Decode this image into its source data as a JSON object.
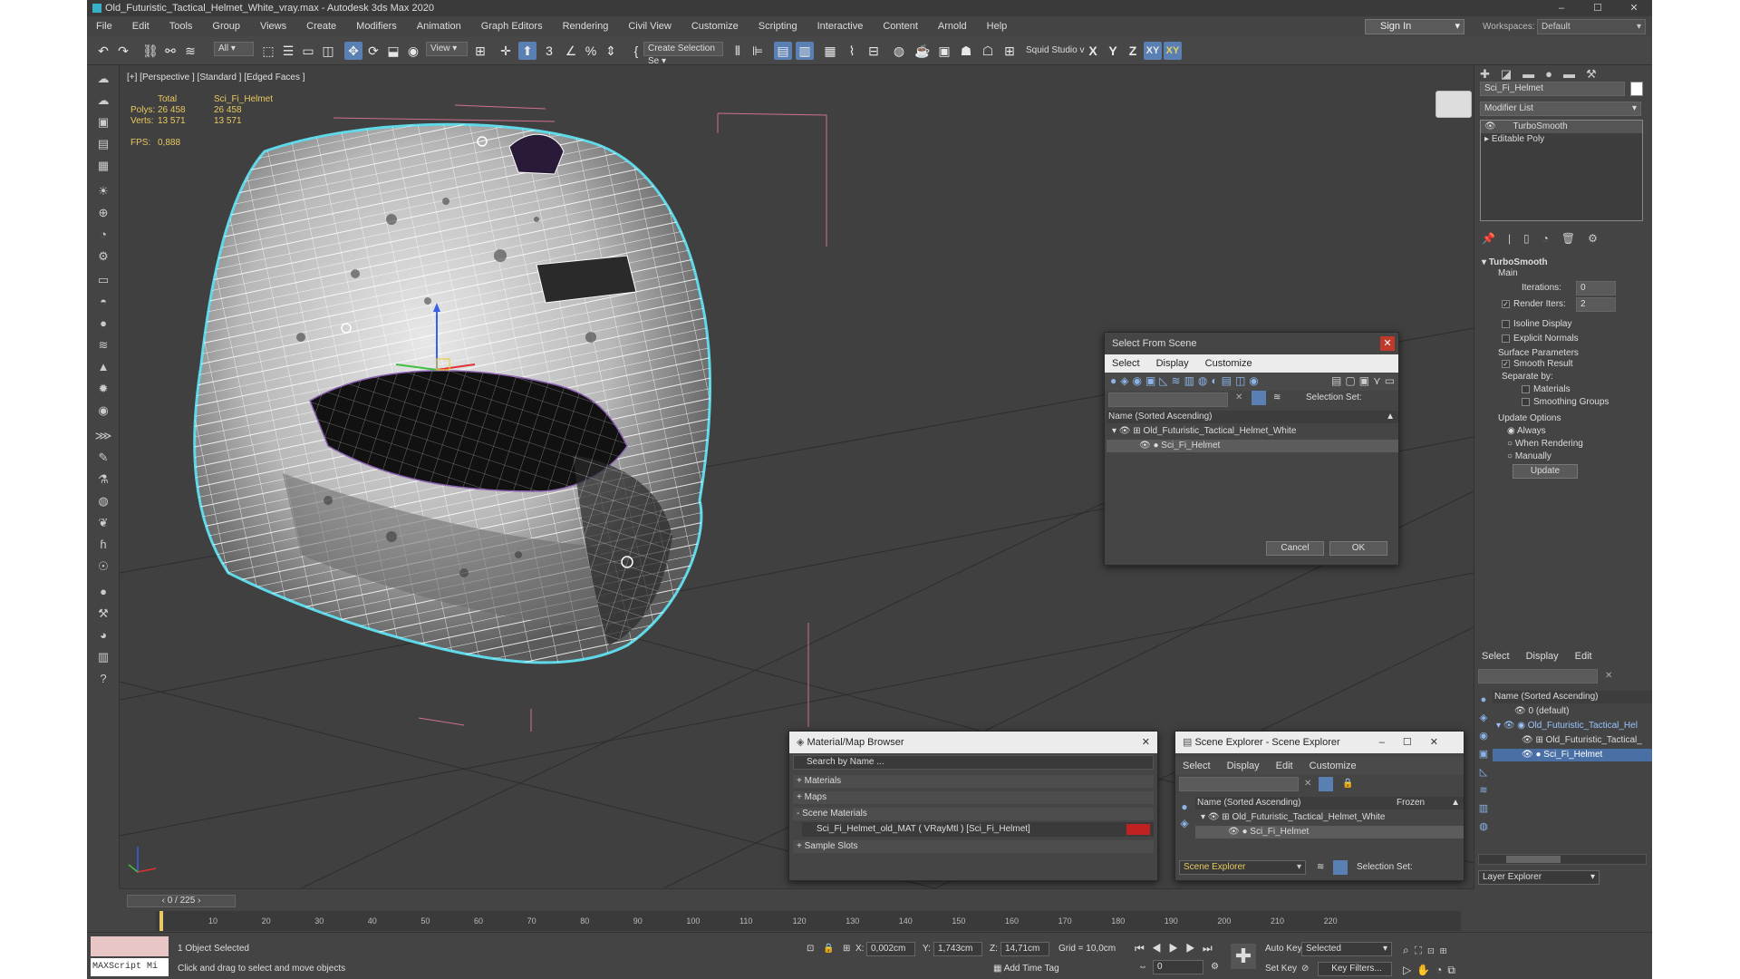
{
  "window": {
    "title": "Old_Futuristic_Tactical_Helmet_White_vray.max - Autodesk 3ds Max 2020",
    "min": "–",
    "max": "☐",
    "close": "✕"
  },
  "menu": [
    "File",
    "Edit",
    "Tools",
    "Group",
    "Views",
    "Create",
    "Modifiers",
    "Animation",
    "Graph Editors",
    "Rendering",
    "Civil View",
    "Customize",
    "Scripting",
    "Interactive",
    "Content",
    "Arnold",
    "Help"
  ],
  "account": {
    "signin": "Sign In",
    "workspace_label": "Workspaces:",
    "workspace_value": "Default"
  },
  "toolbar": {
    "filter": "All",
    "view": "View",
    "selection_set": "Create Selection Se",
    "user": "Squid Studio v",
    "axes": [
      "X",
      "Y",
      "Z",
      "XY",
      "XY"
    ]
  },
  "viewport": {
    "label": "[+] [Perspective ] [Standard ] [Edged Faces ]",
    "stats": {
      "total_label": "Total",
      "object_label": "Sci_Fi_Helmet",
      "polys_label": "Polys:",
      "polys_total": "26 458",
      "polys_obj": "26 458",
      "verts_label": "Verts:",
      "verts_total": "13 571",
      "verts_obj": "13 571",
      "fps_label": "FPS:",
      "fps_value": "0,888"
    }
  },
  "select_from_scene": {
    "title": "Select From Scene",
    "menu": [
      "Select",
      "Display",
      "Customize"
    ],
    "selection_set_label": "Selection Set:",
    "column": "Name (Sorted Ascending)",
    "items": [
      "Old_Futuristic_Tactical_Helmet_White",
      "Sci_Fi_Helmet"
    ],
    "ok": "OK",
    "cancel": "Cancel"
  },
  "material_browser": {
    "title": "Material/Map Browser",
    "search_placeholder": "Search by Name ...",
    "sections": [
      "+ Materials",
      "+ Maps",
      "- Scene Materials",
      "+ Sample Slots"
    ],
    "material_item": "Sci_Fi_Helmet_old_MAT  ( VRayMtl )  [Sci_Fi_Helmet]"
  },
  "scene_explorer": {
    "title": "Scene Explorer - Scene Explorer",
    "menu": [
      "Select",
      "Display",
      "Edit",
      "Customize"
    ],
    "column": "Name (Sorted Ascending)",
    "frozen": "Frozen",
    "items": [
      "Old_Futuristic_Tactical_Helmet_White",
      "Sci_Fi_Helmet"
    ],
    "footer_name": "Scene Explorer",
    "selection_set_label": "Selection Set:"
  },
  "command_panel": {
    "object_name": "Sci_Fi_Helmet",
    "modifier_list": "Modifier List",
    "stack": [
      "TurboSmooth",
      "Editable Poly"
    ],
    "rollout_title": "TurboSmooth",
    "main_label": "Main",
    "iterations_label": "Iterations:",
    "iterations_value": "0",
    "render_iters_label": "Render Iters:",
    "render_iters_value": "2",
    "isoline": "Isoline Display",
    "explicit": "Explicit Normals",
    "surface_params": "Surface Parameters",
    "smooth_result": "Smooth Result",
    "separate_by": "Separate by:",
    "materials": "Materials",
    "smoothing_groups": "Smoothing Groups",
    "update_options": "Update Options",
    "always": "Always",
    "when_rendering": "When Rendering",
    "manually": "Manually",
    "update": "Update"
  },
  "layer_explorer": {
    "menu": [
      "Select",
      "Display",
      "Edit"
    ],
    "column": "Name (Sorted Ascending)",
    "items": [
      "0 (default)",
      "Old_Futuristic_Tactical_Hel",
      "Old_Futuristic_Tactical_",
      "Sci_Fi_Helmet"
    ],
    "footer": "Layer Explorer"
  },
  "timeline": {
    "frame": "0 / 225",
    "ticks": [
      "10",
      "20",
      "30",
      "40",
      "50",
      "60",
      "70",
      "80",
      "90",
      "100",
      "110",
      "120",
      "130",
      "140",
      "150",
      "160",
      "170",
      "180",
      "190",
      "200",
      "210",
      "220"
    ]
  },
  "status": {
    "maxscript": "MAXScript Mi",
    "selected": "1 Object Selected",
    "hint": "Click and drag to select and move objects",
    "x_label": "X:",
    "x_value": "0,002cm",
    "y_label": "Y:",
    "y_value": "1,743cm",
    "z_label": "Z:",
    "z_value": "14,71cm",
    "grid": "Grid = 10,0cm",
    "add_time_tag": "Add Time Tag",
    "auto_key": "Auto Key",
    "set_key": "Set Key",
    "key_mode": "Selected",
    "key_filters": "Key Filters...",
    "frame_field": "0"
  }
}
